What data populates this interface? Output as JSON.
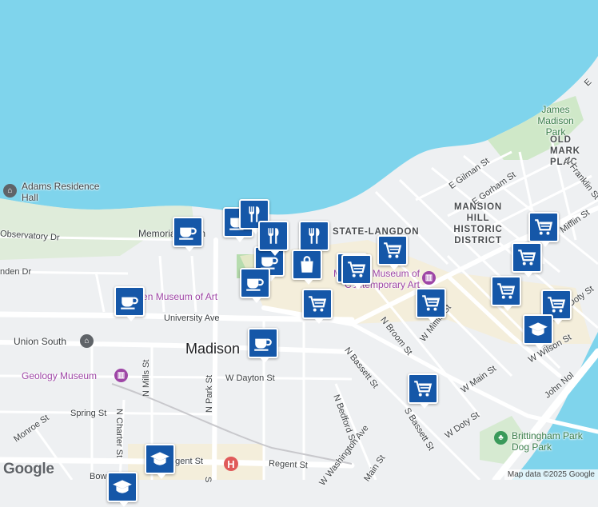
{
  "map": {
    "colors": {
      "water": "#7fd4ec",
      "land": "#eef0f2",
      "park": "#cfe8c8",
      "road_major": "#ffffff",
      "road_minor": "#ffffff",
      "commercial": "#f6ecd2",
      "pin": "#1557a8"
    },
    "city_label": "Madison",
    "area_labels": {
      "state_langdon": "STATE-LANGDON",
      "mansion_hill": "MANSION HILL HISTORIC DISTRICT",
      "old_market": "OLD MARK PLAC",
      "james_madison_park": "James Madison Park"
    },
    "poi_labels": {
      "adams_hall": "Adams Residence Hall",
      "memorial_union": "Memorial Union",
      "chazen": "Chazen Museum of Art",
      "mmoca": "Madison Museum of Contemporary Art",
      "union_south": "Union South",
      "geology": "Geology Museum",
      "brittingham": "Brittingham Park Dog Park"
    },
    "road_labels": {
      "university": "University Ave",
      "observatory": "Observatory Dr",
      "linden": "nden Dr",
      "dayton": "W Dayton St",
      "spring": "Spring St",
      "monroe": "Monroe St",
      "regent": "Regent St",
      "regent2": "egent St",
      "bowen": "Bow",
      "n_park": "N Park St",
      "n_mills": "N Mills St",
      "n_charter": "N Charter St",
      "n_broom": "N Broom St",
      "n_bassett": "N Bassett St",
      "s_bassett": "S Bassett St",
      "n_bedford": "N Bedford St",
      "w_washington": "W Washington Ave",
      "w_mifflin": "W Mifflin St",
      "w_main": "W Main St",
      "w_doty": "W Doty St",
      "w_wilson": "W Wilson St",
      "john_nolen": "John Nol",
      "e_gilman": "E Gilman St",
      "e_gorham": "E Gorham St",
      "n_franklin": "N Franklin St",
      "mifflin_e": "Mifflin St",
      "doty_e": "Doty St",
      "s_park": "S",
      "main_st": "Main St",
      "e_edge": "E"
    },
    "markers": [
      {
        "type": "cafe-icon"
      },
      {
        "type": "cafe-icon"
      },
      {
        "type": "cafe-icon"
      },
      {
        "type": "cafe-icon"
      },
      {
        "type": "cafe-icon"
      },
      {
        "type": "cafe-icon"
      },
      {
        "type": "restaurant-icon"
      },
      {
        "type": "restaurant-icon"
      },
      {
        "type": "restaurant-icon"
      },
      {
        "type": "shopping-bag-icon"
      },
      {
        "type": "grocery-cart-icon"
      },
      {
        "type": "grocery-cart-icon"
      },
      {
        "type": "grocery-cart-icon"
      },
      {
        "type": "grocery-cart-icon"
      },
      {
        "type": "grocery-cart-icon"
      },
      {
        "type": "grocery-cart-icon"
      },
      {
        "type": "grocery-cart-icon"
      },
      {
        "type": "grocery-cart-icon"
      },
      {
        "type": "grocery-cart-icon"
      },
      {
        "type": "grocery-cart-icon"
      },
      {
        "type": "school-icon"
      },
      {
        "type": "school-icon"
      },
      {
        "type": "school-icon"
      }
    ]
  },
  "footer": {
    "logo": "Google",
    "attribution": "Map data ©2025 Google"
  }
}
